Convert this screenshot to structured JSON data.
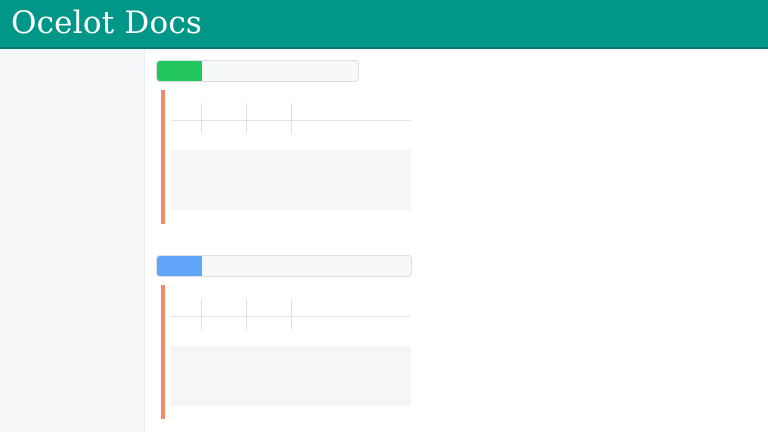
{
  "header": {
    "title": "Ocelot Docs"
  },
  "colors": {
    "header_bg": "#009688",
    "get_badge": "#22c55e",
    "post_badge": "#60a5fa",
    "accent": "#ef8a6a"
  },
  "endpoints": [
    {
      "method": "",
      "path": "",
      "tabs": [
        "",
        "",
        ""
      ]
    },
    {
      "method": "",
      "path": "",
      "tabs": [
        "",
        "",
        ""
      ]
    }
  ]
}
